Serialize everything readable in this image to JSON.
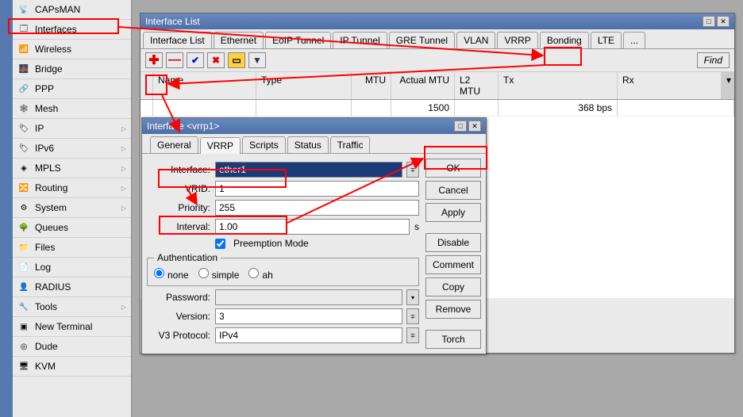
{
  "sidebar": {
    "items": [
      {
        "label": "CAPsMAN",
        "icon": "📡",
        "chev": ""
      },
      {
        "label": "Interfaces",
        "icon": "🗔",
        "chev": ""
      },
      {
        "label": "Wireless",
        "icon": "📶",
        "chev": ""
      },
      {
        "label": "Bridge",
        "icon": "🌉",
        "chev": ""
      },
      {
        "label": "PPP",
        "icon": "🔗",
        "chev": ""
      },
      {
        "label": "Mesh",
        "icon": "🕸",
        "chev": ""
      },
      {
        "label": "IP",
        "icon": "🏷",
        "chev": "▷"
      },
      {
        "label": "IPv6",
        "icon": "🏷",
        "chev": "▷"
      },
      {
        "label": "MPLS",
        "icon": "◈",
        "chev": "▷"
      },
      {
        "label": "Routing",
        "icon": "🔀",
        "chev": "▷"
      },
      {
        "label": "System",
        "icon": "⚙",
        "chev": "▷"
      },
      {
        "label": "Queues",
        "icon": "🌳",
        "chev": ""
      },
      {
        "label": "Files",
        "icon": "📁",
        "chev": ""
      },
      {
        "label": "Log",
        "icon": "📄",
        "chev": ""
      },
      {
        "label": "RADIUS",
        "icon": "👤",
        "chev": ""
      },
      {
        "label": "Tools",
        "icon": "🔧",
        "chev": "▷"
      },
      {
        "label": "New Terminal",
        "icon": "▣",
        "chev": ""
      },
      {
        "label": "Dude",
        "icon": "◎",
        "chev": ""
      },
      {
        "label": "KVM",
        "icon": "🖥",
        "chev": ""
      }
    ]
  },
  "listWindow": {
    "title": "Interface List",
    "tabs": [
      "Interface List",
      "Ethernet",
      "EoIP Tunnel",
      "IP Tunnel",
      "GRE Tunnel",
      "VLAN",
      "VRRP",
      "Bonding",
      "LTE",
      "..."
    ],
    "find": "Find",
    "cols": {
      "name": "Name",
      "type": "Type",
      "mtu": "MTU",
      "amtu": "Actual MTU",
      "l2mtu": "L2 MTU",
      "tx": "Tx",
      "rx": "Rx"
    },
    "row": {
      "amtu": "1500",
      "tx": "368 bps"
    }
  },
  "dialog": {
    "title": "Interface <vrrp1>",
    "tabs": [
      "General",
      "VRRP",
      "Scripts",
      "Status",
      "Traffic"
    ],
    "buttons": {
      "ok": "OK",
      "cancel": "Cancel",
      "apply": "Apply",
      "disable": "Disable",
      "comment": "Comment",
      "copy": "Copy",
      "remove": "Remove",
      "torch": "Torch"
    },
    "form": {
      "iface_lbl": "Interface:",
      "iface_val": "ether1",
      "vrid_lbl": "VRID:",
      "vrid_val": "1",
      "prio_lbl": "Priority:",
      "prio_val": "255",
      "intv_lbl": "Interval:",
      "intv_val": "1.00",
      "intv_unit": "s",
      "preempt": "Preemption Mode",
      "auth_legend": "Authentication",
      "auth_none": "none",
      "auth_simple": "simple",
      "auth_ah": "ah",
      "pwd_lbl": "Password:",
      "ver_lbl": "Version:",
      "ver_val": "3",
      "v3p_lbl": "V3 Protocol:",
      "v3p_val": "IPv4"
    }
  }
}
